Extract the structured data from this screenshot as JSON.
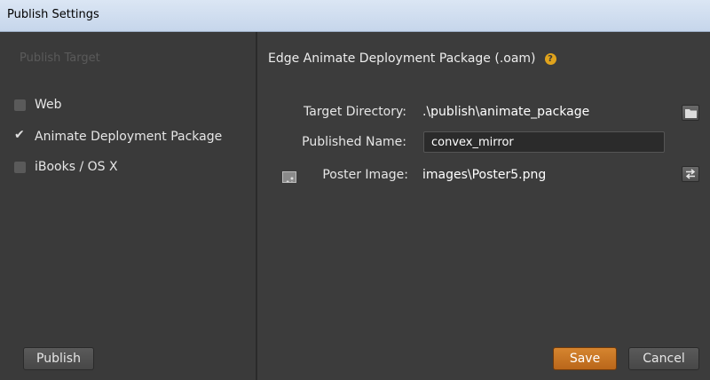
{
  "window": {
    "title": "Publish Settings"
  },
  "sidebar": {
    "heading": "Publish Target",
    "targets": [
      {
        "label": "Web",
        "checked": false
      },
      {
        "label": "Animate Deployment Package",
        "checked": true
      },
      {
        "label": "iBooks / OS X",
        "checked": false
      }
    ],
    "publish_label": "Publish"
  },
  "main": {
    "title": "Edge Animate Deployment Package (.oam)",
    "help_glyph": "?",
    "fields": {
      "target_directory_label": "Target Directory:",
      "target_directory_value": ".\\publish\\animate_package",
      "published_name_label": "Published Name:",
      "published_name_value": "convex_mirror",
      "poster_image_label": "Poster Image:",
      "poster_image_value": "images\\Poster5.png"
    },
    "icons": {
      "folder": "folder-icon",
      "swap": "swap-icon",
      "image": "image-icon",
      "help": "help-icon"
    }
  },
  "footer": {
    "save_label": "Save",
    "cancel_label": "Cancel"
  },
  "colors": {
    "accent": "#d6852f",
    "panel": "#3a3a3a",
    "help_badge": "#e0a31c"
  }
}
